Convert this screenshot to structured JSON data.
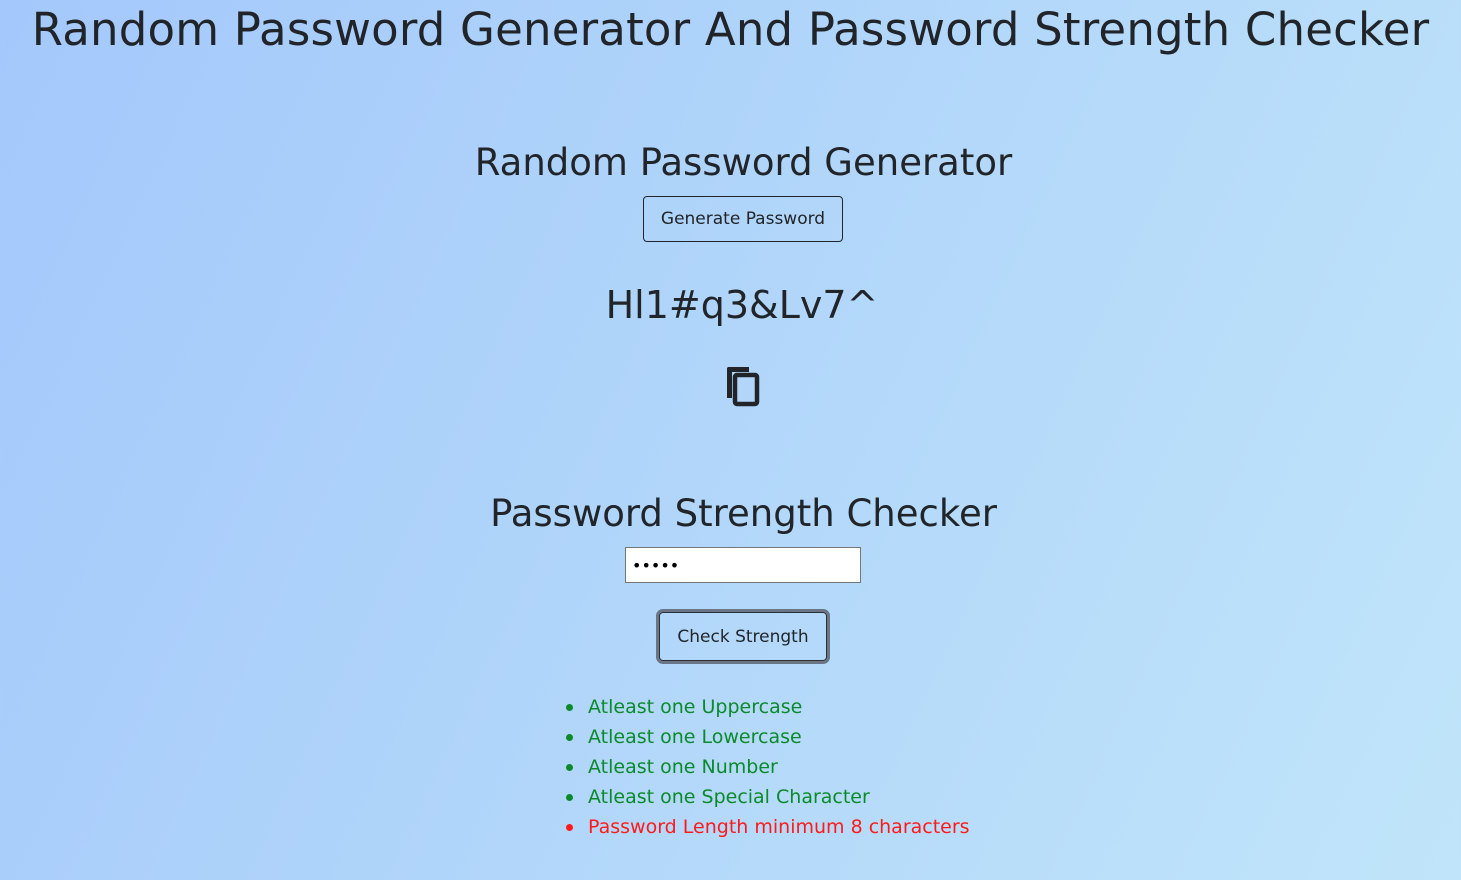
{
  "page": {
    "title": "Random Password Generator And Password Strength Checker"
  },
  "generator": {
    "heading": "Random Password Generator",
    "button_label": "Generate Password",
    "generated_password": "Hl1#q3&Lv7^",
    "copy_icon": "copy-icon"
  },
  "checker": {
    "heading": "Password Strength Checker",
    "input_value": "•••••",
    "button_label": "Check Strength",
    "rules": [
      {
        "label": "Atleast one Uppercase",
        "status": "ok"
      },
      {
        "label": "Atleast one Lowercase",
        "status": "ok"
      },
      {
        "label": "Atleast one Number",
        "status": "ok"
      },
      {
        "label": "Atleast one Special Character",
        "status": "ok"
      },
      {
        "label": "Password Length minimum 8 characters",
        "status": "fail"
      }
    ]
  },
  "colors": {
    "ok": "#0a8a2a",
    "fail": "#ff1a1a",
    "text": "#212529"
  }
}
